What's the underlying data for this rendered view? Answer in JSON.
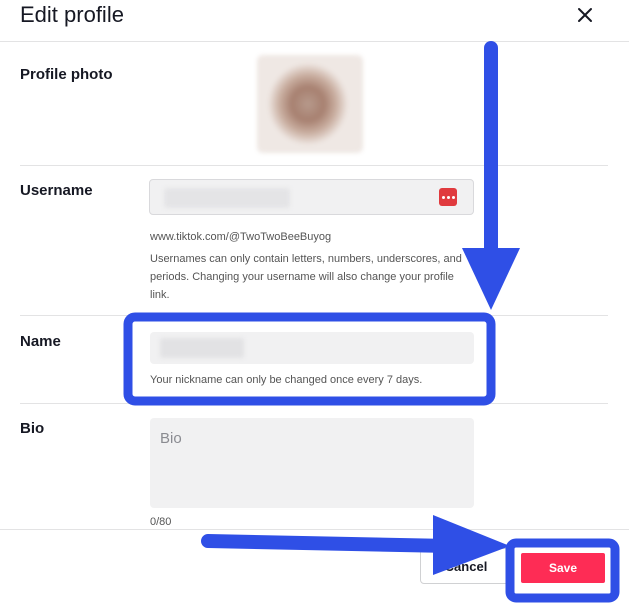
{
  "header": {
    "title": "Edit profile",
    "close_icon": "close-icon"
  },
  "profile_photo": {
    "label": "Profile photo"
  },
  "username": {
    "label": "Username",
    "link": "www.tiktok.com/@TwoTwoBeeBuyog",
    "help_lines": [
      "Usernames can only contain letters, numbers, underscores, and",
      "periods. Changing your username will also change your profile",
      "link."
    ]
  },
  "name": {
    "label": "Name",
    "help": "Your nickname can only be changed once every 7 days."
  },
  "bio": {
    "label": "Bio",
    "placeholder": "Bio",
    "count": "0/80"
  },
  "footer": {
    "cancel_label": "Cancel",
    "save_label": "Save"
  },
  "colors": {
    "accent": "#fe2c55",
    "annotation": "#2f4fe6",
    "password_icon": "#e03a3e"
  }
}
